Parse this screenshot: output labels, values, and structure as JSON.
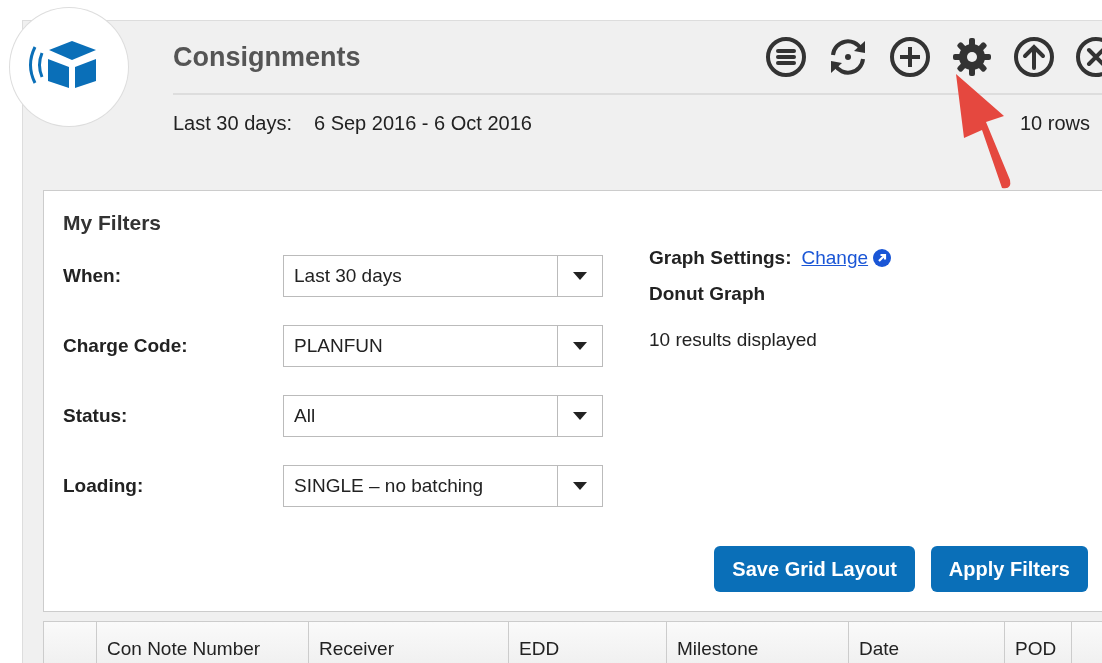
{
  "header": {
    "title": "Consignments",
    "range_label": "Last 30 days:",
    "range_value": "6 Sep 2016 - 6 Oct 2016",
    "row_count": "10 rows"
  },
  "filters": {
    "title": "My Filters",
    "fields": [
      {
        "label": "When:",
        "value": "Last 30 days"
      },
      {
        "label": "Charge Code:",
        "value": "PLANFUN"
      },
      {
        "label": "Status:",
        "value": "All"
      },
      {
        "label": "Loading:",
        "value": "SINGLE – no batching"
      }
    ],
    "graph_settings": {
      "label": "Graph Settings:",
      "link": "Change"
    },
    "graph_type": "Donut Graph",
    "results": "10 results displayed",
    "buttons": [
      "Save Grid Layout",
      "Apply Filters"
    ]
  },
  "table": {
    "columns": [
      "Con Note Number",
      "Receiver",
      "EDD",
      "Milestone",
      "Date",
      "POD"
    ]
  }
}
